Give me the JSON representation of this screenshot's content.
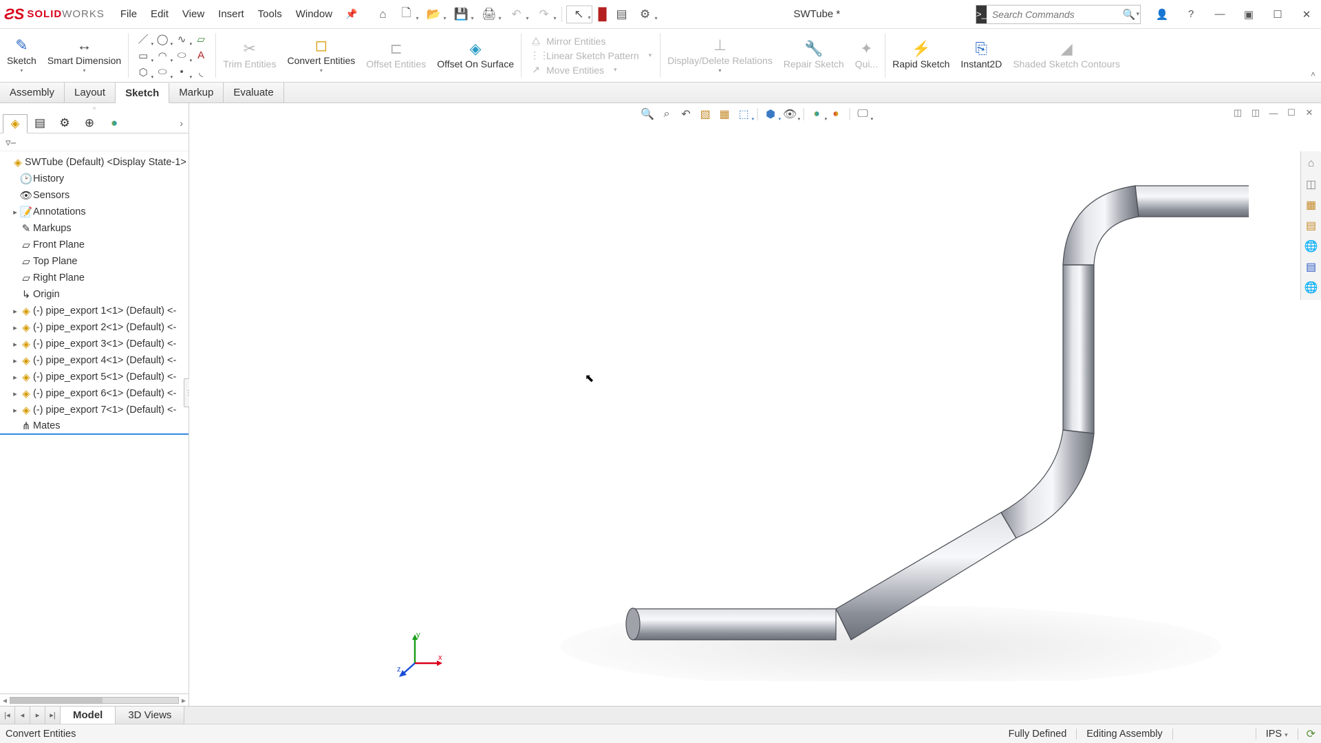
{
  "app": {
    "brand_bold": "SOLID",
    "brand_rest": "WORKS",
    "document_title": "SWTube *"
  },
  "menu": [
    "File",
    "Edit",
    "View",
    "Insert",
    "Tools",
    "Window"
  ],
  "search": {
    "placeholder": "Search Commands"
  },
  "ribbon": {
    "sketch": "Sketch",
    "smart_dimension": "Smart Dimension",
    "trim": "Trim Entities",
    "convert": "Convert Entities",
    "offset": "Offset Entities",
    "offset_surface": "Offset On Surface",
    "mirror": "Mirror Entities",
    "linear_pattern": "Linear Sketch Pattern",
    "move": "Move Entities",
    "ddr": "Display/Delete Relations",
    "repair": "Repair Sketch",
    "quick": "Qui...",
    "rapid": "Rapid Sketch",
    "instant2d": "Instant2D",
    "shaded": "Shaded Sketch Contours"
  },
  "tabs": [
    "Assembly",
    "Layout",
    "Sketch",
    "Markup",
    "Evaluate"
  ],
  "tabs_active_index": 2,
  "tree": {
    "root": "SWTube (Default) <Display State-1>",
    "history": "History",
    "sensors": "Sensors",
    "annotations": "Annotations",
    "markups": "Markups",
    "front_plane": "Front Plane",
    "top_plane": "Top Plane",
    "right_plane": "Right Plane",
    "origin": "Origin",
    "components": [
      "(-) pipe_export 1<1> (Default) <-",
      "(-) pipe_export 2<1> (Default) <-",
      "(-) pipe_export 3<1> (Default) <-",
      "(-) pipe_export 4<1> (Default) <-",
      "(-) pipe_export 5<1> (Default) <-",
      "(-) pipe_export 6<1> (Default) <-",
      "(-) pipe_export 7<1> (Default) <-"
    ],
    "mates": "Mates"
  },
  "triad": {
    "x": "x",
    "y": "y",
    "z": "z"
  },
  "bottom_tabs": [
    "Model",
    "3D Views"
  ],
  "bottom_tabs_active_index": 0,
  "status": {
    "hint": "Convert Entities",
    "defined": "Fully Defined",
    "mode": "Editing Assembly",
    "units": "IPS"
  }
}
